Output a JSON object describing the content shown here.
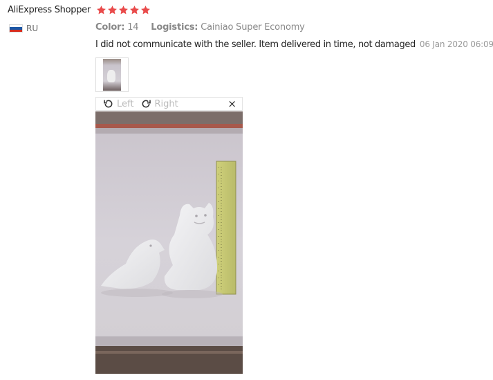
{
  "review": {
    "reviewer": "AliExpress Shopper",
    "rating": 5,
    "country": "RU",
    "color_label": "Color:",
    "color_value": "14",
    "logistics_label": "Logistics:",
    "logistics_value": "Cainiao Super Economy",
    "text": "I did not communicate with the seller. Item delivered in time, not damaged",
    "date": "06 Jan 2020 06:09"
  },
  "viewer": {
    "rotate_left": "Left",
    "rotate_right": "Right",
    "close": "×"
  },
  "colors": {
    "star": "#e94b4b",
    "flag_white": "#ffffff",
    "flag_blue": "#1c57a5",
    "flag_red": "#d52b1e"
  }
}
